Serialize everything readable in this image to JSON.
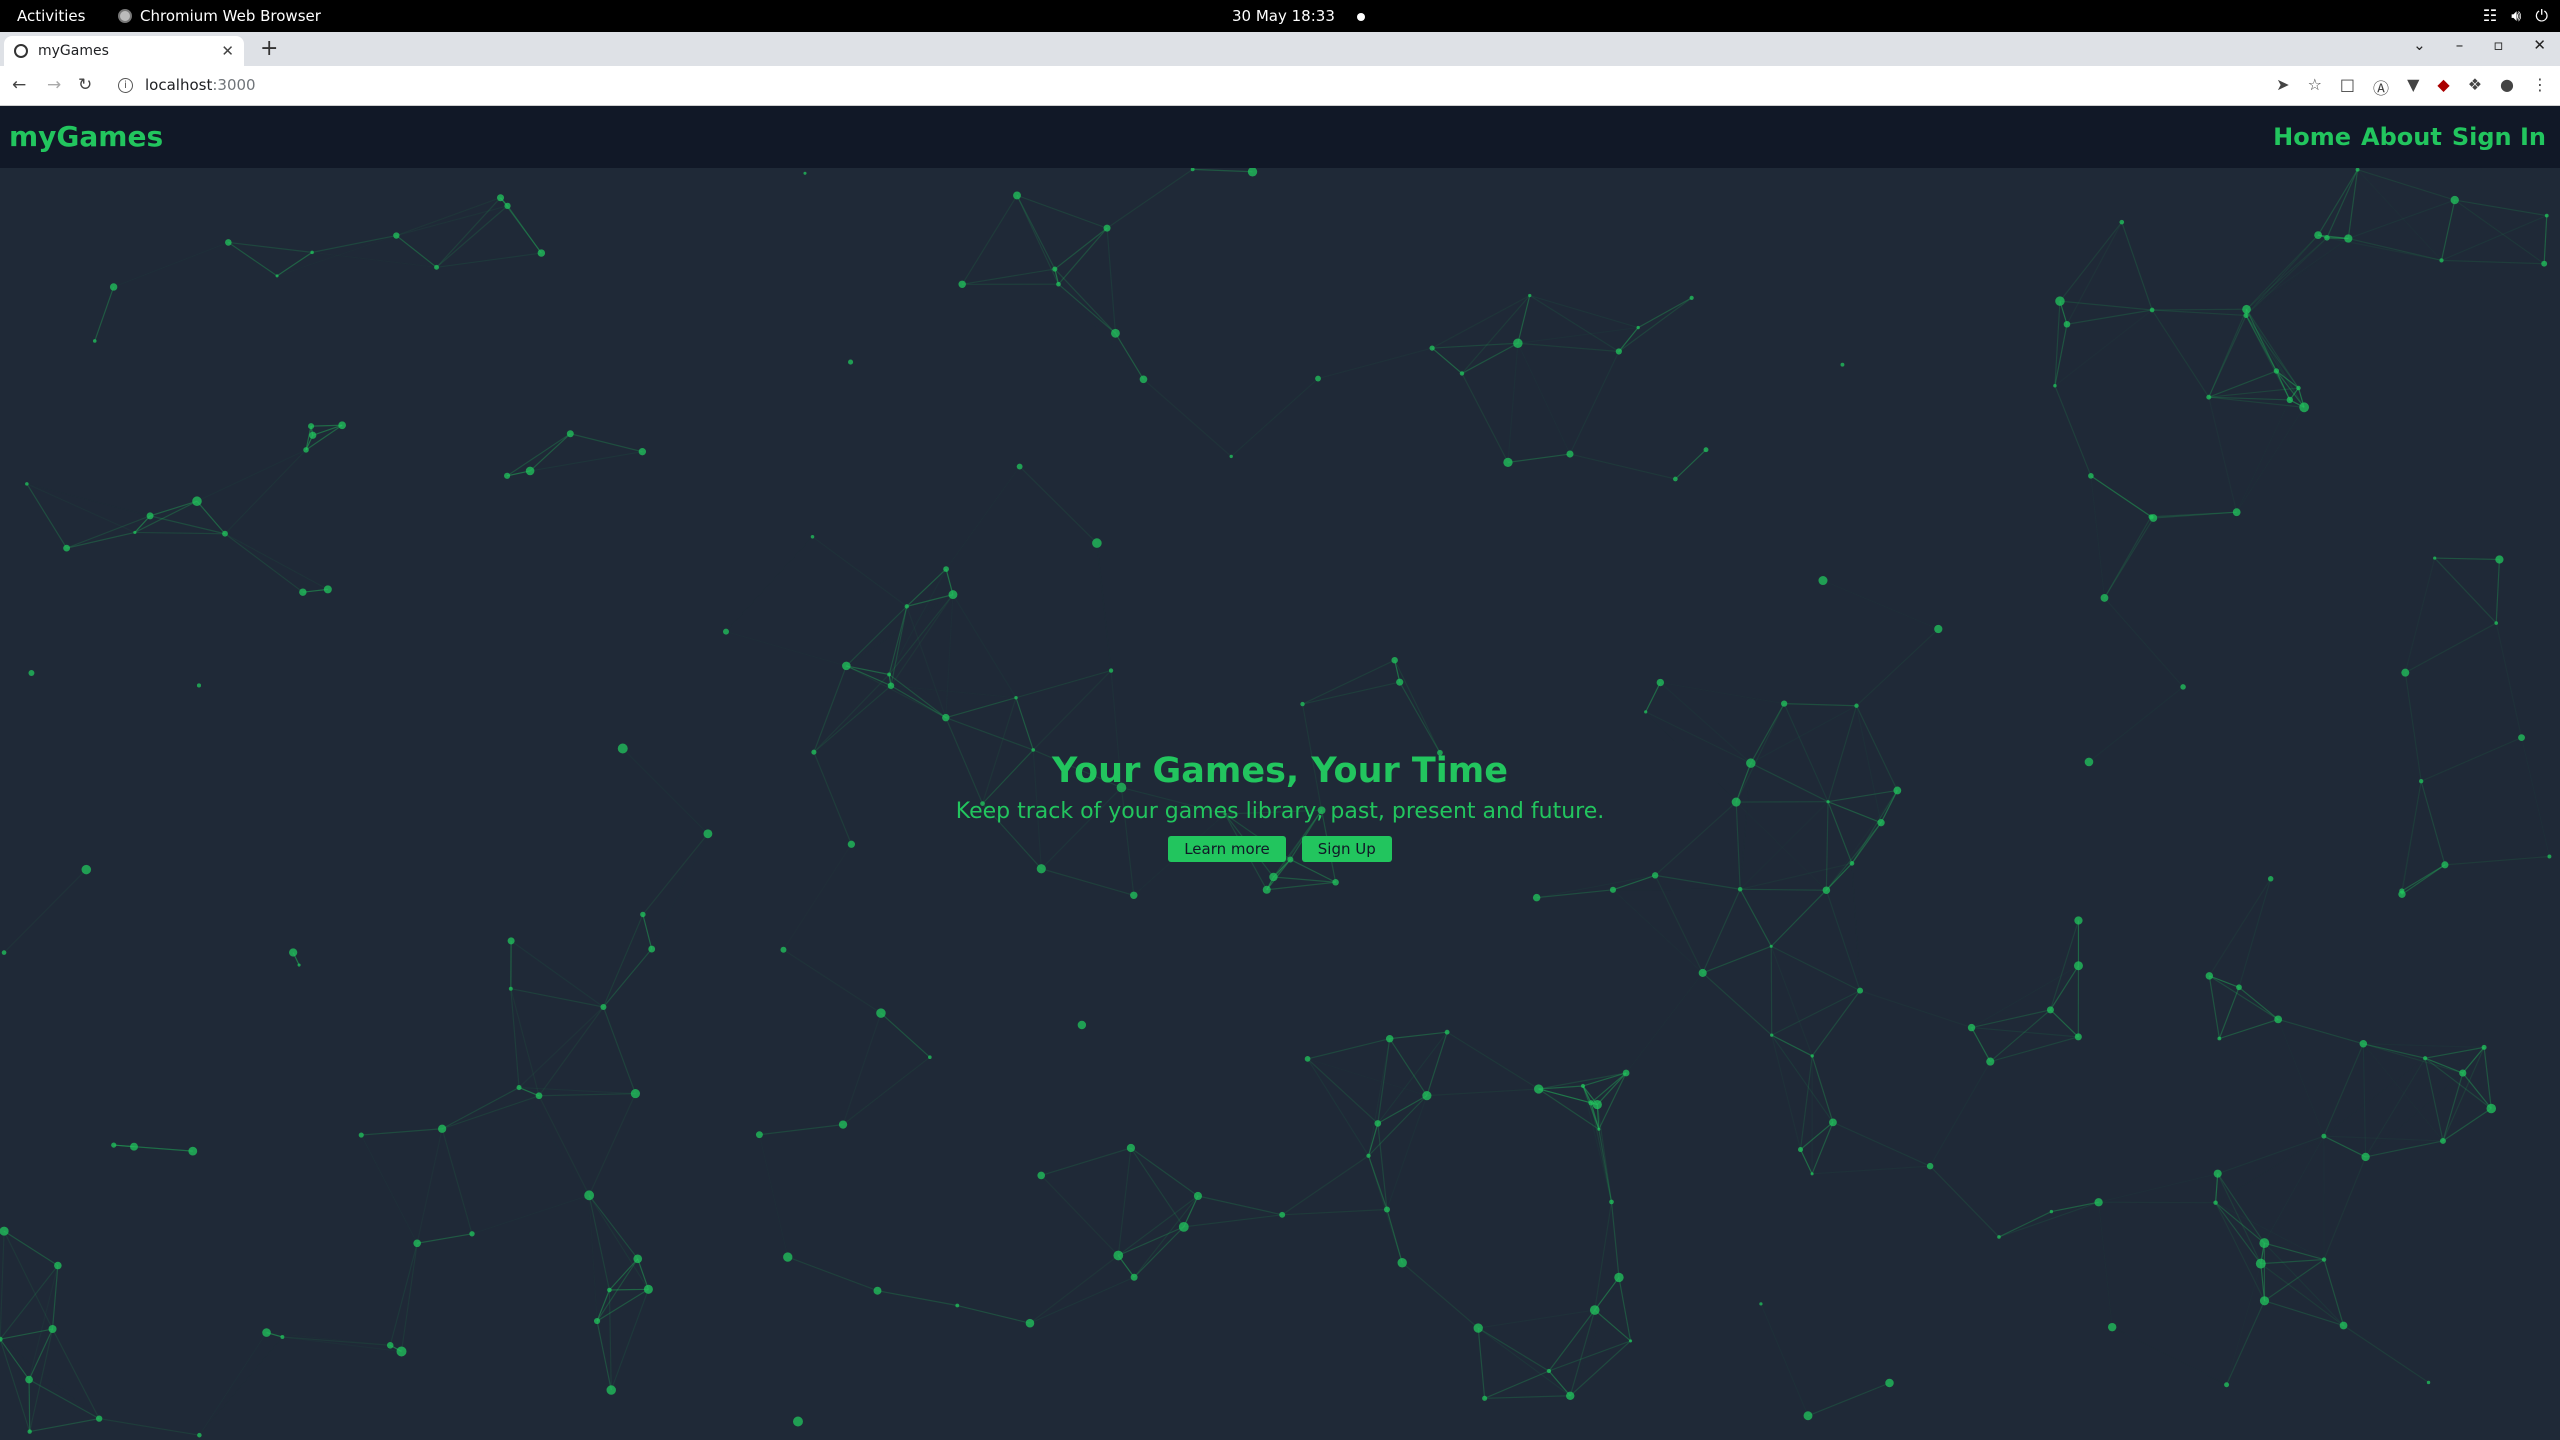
{
  "os": {
    "activities": "Activities",
    "app_name": "Chromium Web Browser",
    "clock": "30 May  18:33"
  },
  "browser": {
    "tab_title": "myGames",
    "url_host": "localhost",
    "url_port": ":3000"
  },
  "site": {
    "brand": "myGames",
    "nav": [
      "Home",
      "About",
      "Sign In"
    ]
  },
  "hero": {
    "title": "Your Games, Your Time",
    "subtitle": "Keep track of your games library, past, present and future.",
    "learn_more": "Learn more",
    "sign_up": "Sign Up"
  },
  "colors": {
    "accent": "#22c55e",
    "background": "#1f2937",
    "navbar": "#111827"
  }
}
